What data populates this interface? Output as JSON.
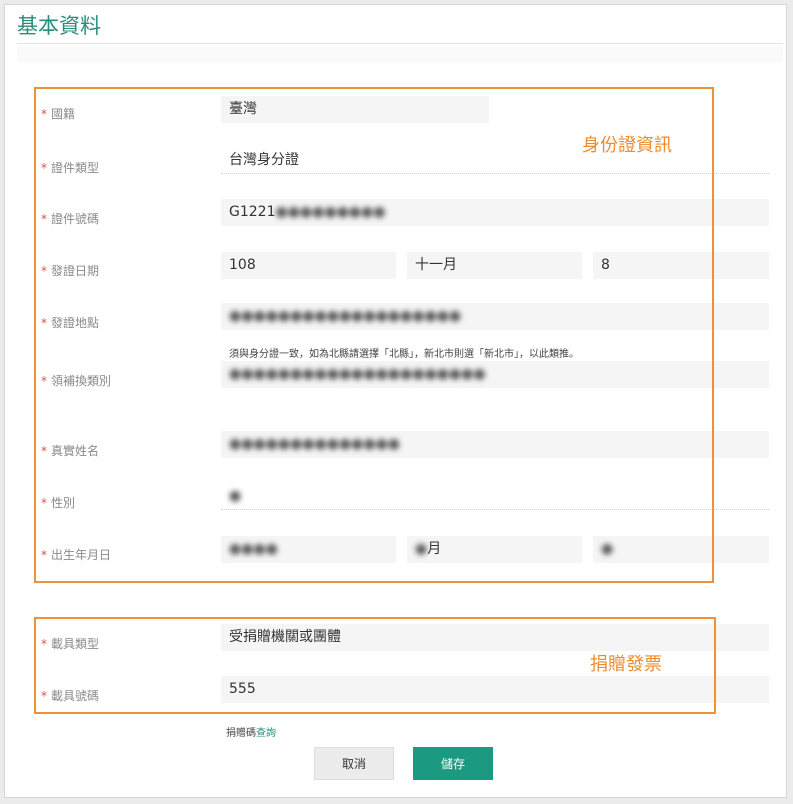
{
  "page": {
    "title": "基本資料"
  },
  "required_mark": "*",
  "identity": {
    "nationality_label": "國籍",
    "nationality_value": "臺灣",
    "id_type_label": "證件類型",
    "id_type_value": "台灣身分證",
    "id_number_label": "證件號碼",
    "id_number_value": "G1221",
    "issue_date_label": "發證日期",
    "issue_year": "108",
    "issue_month": "十一月",
    "issue_day": "8",
    "issue_place_label": "發證地點",
    "issue_place_hint": "須與身分證一致，如為北縣請選擇「北縣」，新北市則選「新北市」，以此類推。",
    "reissue_type_label": "領補換類別",
    "real_name_label": "真實姓名",
    "gender_label": "性別",
    "birth_label": "出生年月日",
    "birth_month_suffix": "月"
  },
  "carrier": {
    "type_label": "載具類型",
    "type_value": "受捐贈機關或團體",
    "number_label": "載具號碼",
    "number_value": "555",
    "lookup_prefix": "捐贈碼",
    "lookup_link": "查詢"
  },
  "annotations": {
    "identity_box": "身份證資訊",
    "donation_box": "捐贈發票",
    "color": "#f0913a"
  },
  "buttons": {
    "cancel": "取消",
    "save": "儲存"
  },
  "colors": {
    "accent": "#2a8c7c",
    "save_bg": "#1c9a81",
    "required": "#d9534f"
  }
}
